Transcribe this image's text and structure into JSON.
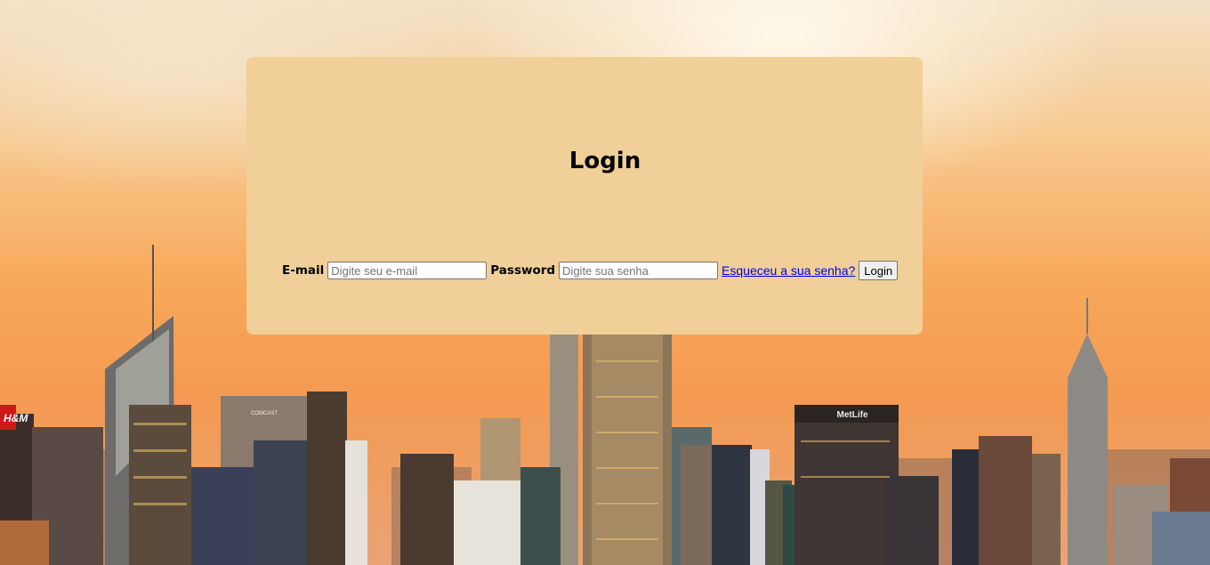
{
  "login": {
    "title": "Login",
    "email_label": "E-mail",
    "email_placeholder": "Digite seu e-mail",
    "email_value": "",
    "password_label": "Password",
    "password_placeholder": "Digite sua senha",
    "password_value": "",
    "forgot_link": "Esqueceu a sua senha?",
    "submit_label": "Login"
  },
  "colors": {
    "card_background": "#f0cf98",
    "link": "#0000ee",
    "sky_top": "#f3e1c6",
    "sky_bottom": "#f49a52"
  },
  "background": {
    "metlife_sign": "MetLife",
    "comcast_sign": "COMCAST",
    "hm_sign": "H&M"
  }
}
